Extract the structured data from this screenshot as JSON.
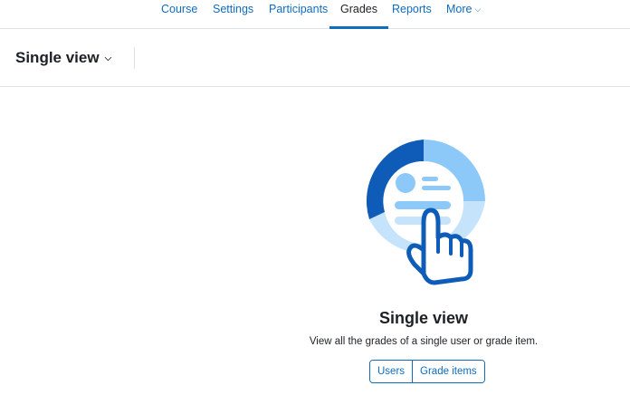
{
  "nav": {
    "items": [
      {
        "label": "Course"
      },
      {
        "label": "Settings"
      },
      {
        "label": "Participants"
      },
      {
        "label": "Grades",
        "active": true
      },
      {
        "label": "Reports"
      },
      {
        "label": "More"
      }
    ]
  },
  "header": {
    "view_select_label": "Single view"
  },
  "empty_state": {
    "title": "Single view",
    "description": "View all the grades of a single user or grade item.",
    "buttons": {
      "users": "Users",
      "grade_items": "Grade items"
    }
  },
  "colors": {
    "link": "#0f6cbf",
    "dark_blue": "#0f5cb8",
    "light_blue": "#8cc9f9",
    "pale_blue": "#c5e3fb"
  },
  "icons": {
    "more_chevron": "chevron-down-icon",
    "view_chevron": "chevron-down-icon",
    "illustration": "pointing-hand-icon"
  }
}
